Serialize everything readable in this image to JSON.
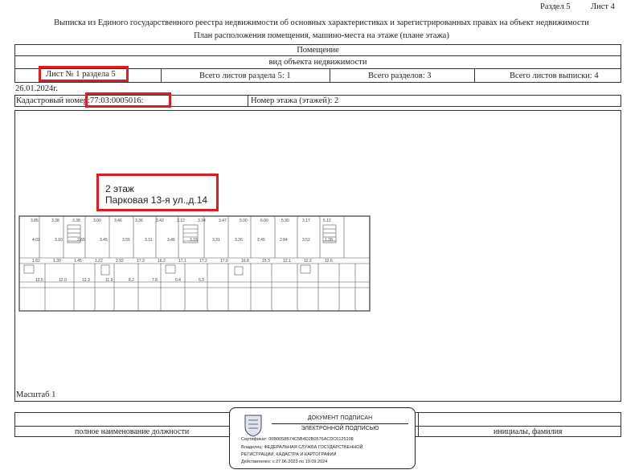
{
  "header": {
    "section": "Раздел 5",
    "sheet": "Лист 4",
    "title_line1": "Выписка из Единого государственного реестра недвижимости об основных характеристиках и зарегистрированных правах на объект недвижимости",
    "title_line2": "План расположения помещения, машино-места на этаже (плане этажа)"
  },
  "form": {
    "object_type": "Помещение",
    "object_type_caption": "вид объекта недвижимости",
    "sheet_of_section": "Лист № 1 раздела 5",
    "total_sheets_section": "Всего листов раздела 5: 1",
    "total_sections": "Всего разделов: 3",
    "total_sheets_extract": "Всего листов выписки: 4",
    "date": "26.01.2024г.",
    "cadastral_label": "Кадастровый номер:",
    "cadastral_number": "77:03:0005016:",
    "floor_label": "Номер этажа (этажей): 2"
  },
  "plan": {
    "annotation_line1": "2 этаж",
    "annotation_line2": "Парковая 13-я ул.,д.14",
    "scale": "Масштаб 1",
    "room_labels": [
      "3.85",
      "3.38",
      "3.38",
      "3.00",
      "3.46",
      "3.36",
      "3.42",
      "3.12",
      "3.34",
      "3.47",
      "5.00",
      "6.00",
      "5.30",
      "3.17",
      "5.12",
      "4.02",
      "3.10",
      "2.65",
      "3.45",
      "3.55",
      "3.11",
      "3.45",
      "3.15",
      "3.31",
      "3.26",
      "2.45",
      "2.84",
      "3.52",
      "1.28",
      "1.62",
      "1.30",
      "1.45",
      "1.22",
      "2.92",
      "17.3",
      "16.3",
      "17.1",
      "17.2",
      "17.0",
      "16.8",
      "15.3",
      "12.1",
      "12.2",
      "12.6",
      "12.5",
      "12.0",
      "12.3",
      "11.9",
      "8.2",
      "7.8",
      "6.4",
      "5.3"
    ]
  },
  "footer": {
    "position_caption": "полное наименование должности",
    "name_caption": "инициалы, фамилия",
    "sign_title": "ДОКУМЕНТ ПОДПИСАН",
    "sign_subtitle": "ЭЛЕКТРОННОЙ ПОДПИСЬЮ",
    "certificate": "Сертификат: 00B0058B74C5B4D2B0576ACDC6125108",
    "owner_line1": "Владелец: ФЕДЕРАЛЬНАЯ СЛУЖБА ГОСУДАРСТВЕННОЙ",
    "owner_line2": "РЕГИСТРАЦИИ, КАДАСТРА И КАРТОГРАФИИ",
    "valid": "Действителен: с 27.06.2023 по 19.09.2024"
  },
  "colors": {
    "highlight": "#e01b24",
    "line": "#333333"
  }
}
